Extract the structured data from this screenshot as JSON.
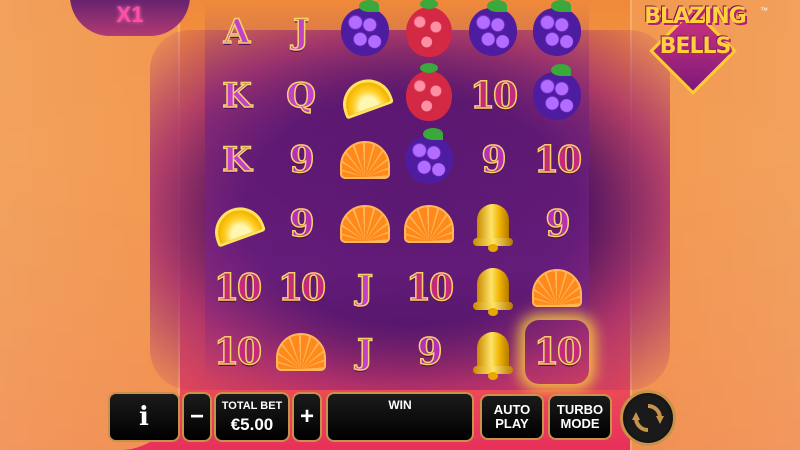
{
  "multiplier": "X1",
  "logo": {
    "line1": "BLAZING",
    "line2": "BELLS",
    "trademark": "™"
  },
  "grid": {
    "columns": [
      [
        "A",
        "K",
        "K",
        "lemon",
        "10",
        "10"
      ],
      [
        "J",
        "Q",
        "9",
        "9",
        "10",
        "orange"
      ],
      [
        "blackberry",
        "lemon",
        "orange",
        "orange",
        "J",
        "J"
      ],
      [
        "raspberry",
        "raspberry",
        "blackberry",
        "orange",
        "10",
        "9"
      ],
      [
        "blackberry",
        "10",
        "9",
        "bell",
        "bell",
        "bell"
      ],
      [
        "blackberry",
        "blackberry",
        "10",
        "9",
        "orange",
        "10"
      ]
    ],
    "highlighted": [
      "5-5"
    ]
  },
  "controls": {
    "info_label": "i",
    "minus_label": "−",
    "plus_label": "+",
    "total_bet_label": "TOTAL BET",
    "total_bet_value": "€5.00",
    "win_label": "WIN",
    "autoplay_line1": "AUTO",
    "autoplay_line2": "PLAY",
    "turbo_line1": "TURBO",
    "turbo_line2": "MODE",
    "spin_icon": "spin-arrows-icon"
  },
  "colors": {
    "accent": "#c8924a",
    "background_top": "#f08a3a",
    "background_bottom": "#e8305a"
  }
}
